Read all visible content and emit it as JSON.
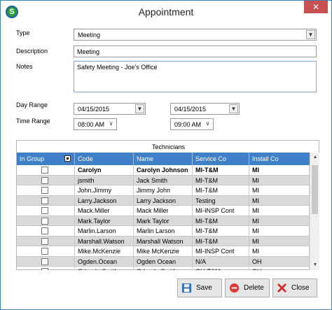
{
  "window": {
    "title": "Appointment",
    "close_glyph": "✕",
    "app_icon_letter": "S"
  },
  "form": {
    "type_label": "Type",
    "type_value": "Meeting",
    "description_label": "Description",
    "description_value": "Meeting",
    "notes_label": "Notes",
    "notes_value": "Safety Meeting - Joe's Office",
    "day_range_label": "Day Range",
    "day_start": "04/15/2015",
    "day_end": "04/15/2015",
    "time_range_label": "Time Range",
    "time_start": "08:00 AM",
    "time_end": "09:00 AM"
  },
  "technicians": {
    "title": "Technicians",
    "columns": [
      "In Group",
      "Code",
      "Name",
      "Service Co",
      "Install Co"
    ],
    "rows": [
      {
        "code": "Carolyn",
        "name": "Carolyn Johnson",
        "service": "MI-T&M",
        "install": "MI"
      },
      {
        "code": "jsmith",
        "name": "Jack Smith",
        "service": "MI-T&M",
        "install": "MI"
      },
      {
        "code": "John.Jimmy",
        "name": "Jimmy John",
        "service": "MI-T&M",
        "install": "MI"
      },
      {
        "code": "Larry.Jackson",
        "name": "Larry Jackson",
        "service": "Testing",
        "install": "MI"
      },
      {
        "code": "Mack.Miller",
        "name": "Mack Miller",
        "service": "MI-INSP Cont",
        "install": "MI"
      },
      {
        "code": "Mark.Taylor",
        "name": "Mark Taylor",
        "service": "MI-T&M",
        "install": "MI"
      },
      {
        "code": "Marlin.Larson",
        "name": "Marlin Larson",
        "service": "MI-T&M",
        "install": "MI"
      },
      {
        "code": "Marshall.Watson",
        "name": "Marshall Watson",
        "service": "MI-T&M",
        "install": "MI"
      },
      {
        "code": "Mike.McKenzie",
        "name": "Mike McKenzie",
        "service": "MI-INSP Cont",
        "install": "MI"
      },
      {
        "code": "Ogden.Ocean",
        "name": "Ogden Ocean",
        "service": "N/A",
        "install": "OH"
      },
      {
        "code": "Orlando.Smith",
        "name": "Orlando Smith",
        "service": "OH-T&M",
        "install": "OH"
      }
    ]
  },
  "buttons": {
    "save": "Save",
    "delete": "Delete",
    "close": "Close"
  },
  "icons": {
    "save": "save-disk-icon",
    "delete": "delete-circle-icon",
    "close": "close-x-icon"
  },
  "colors": {
    "header_blue": "#3f80c8",
    "alt_row": "#d9d9d9",
    "close_button_red": "#c75050"
  }
}
